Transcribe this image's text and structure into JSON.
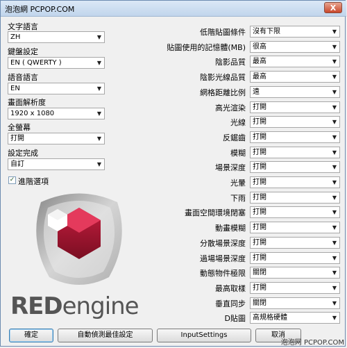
{
  "window": {
    "title": "泡泡網 PCPOP.COM",
    "close_label": "X"
  },
  "left": {
    "text_language": {
      "label": "文字語言",
      "value": "ZH"
    },
    "keyboard": {
      "label": "鍵盤設定",
      "value": "EN ( QWERTY )"
    },
    "voice_language": {
      "label": "語音語言",
      "value": "EN"
    },
    "resolution": {
      "label": "畫面解析度",
      "value": "1920 x 1080"
    },
    "fullscreen": {
      "label": "全螢幕",
      "value": "打開"
    },
    "preset": {
      "label": "設定完成",
      "value": "自訂"
    },
    "advanced": {
      "label": "進階選項",
      "checked": true,
      "mark": "✓"
    }
  },
  "right": {
    "settings": [
      {
        "label": "低階貼圖條件",
        "value": "沒有下限"
      },
      {
        "label": "貼圖使用的記憶體(MB)",
        "value": "很高"
      },
      {
        "label": "陰影品質",
        "value": "最高"
      },
      {
        "label": "陰影光線品質",
        "value": "最高"
      },
      {
        "label": "網格距離比例",
        "value": "遠"
      },
      {
        "label": "高光渲染",
        "value": "打開"
      },
      {
        "label": "光線",
        "value": "打開"
      },
      {
        "label": "反鋸齒",
        "value": "打開"
      },
      {
        "label": "模糊",
        "value": "打開"
      },
      {
        "label": "場景深度",
        "value": "打開"
      },
      {
        "label": "光暈",
        "value": "打開"
      },
      {
        "label": "下雨",
        "value": "打開"
      },
      {
        "label": "畫面空間環境閉塞",
        "value": "打開"
      },
      {
        "label": "動畫模糊",
        "value": "打開"
      },
      {
        "label": "分散場景深度",
        "value": "打開"
      },
      {
        "label": "過場場景深度",
        "value": "打開"
      },
      {
        "label": "動態物件極限",
        "value": "關閉"
      },
      {
        "label": "最高取樣",
        "value": "打開"
      },
      {
        "label": "垂直同步",
        "value": "關閉"
      },
      {
        "label": "D貼圖",
        "value": "高規格硬體"
      }
    ]
  },
  "logo": {
    "red": "RED",
    "engine": "engine"
  },
  "buttons": {
    "ok": "確定",
    "auto_detect": "自動偵測最佳設定",
    "input_settings": "InputSettings",
    "cancel": "取消"
  },
  "watermark": "泡泡网 PCPOP.COM"
}
